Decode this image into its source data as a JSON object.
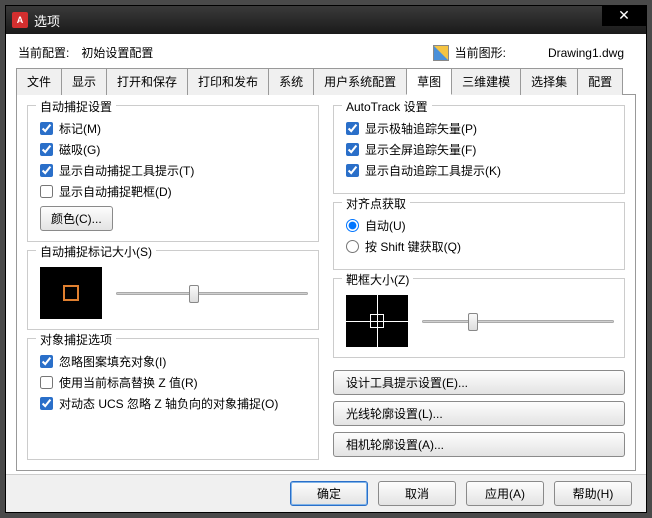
{
  "title": "选项",
  "top": {
    "profile_label": "当前配置:",
    "profile_value": "初始设置配置",
    "drawing_label": "当前图形:",
    "drawing_value": "Drawing1.dwg"
  },
  "tabs": [
    "文件",
    "显示",
    "打开和保存",
    "打印和发布",
    "系统",
    "用户系统配置",
    "草图",
    "三维建模",
    "选择集",
    "配置"
  ],
  "active_tab": 6,
  "left": {
    "autosnap": {
      "title": "自动捕捉设置",
      "marker": "标记(M)",
      "magnet": "磁吸(G)",
      "tooltip": "显示自动捕捉工具提示(T)",
      "aperture": "显示自动捕捉靶框(D)",
      "colors_btn": "颜色(C)..."
    },
    "marker_size": {
      "title": "自动捕捉标记大小(S)"
    },
    "osnap": {
      "title": "对象捕捉选项",
      "hatch": "忽略图案填充对象(I)",
      "elev": "使用当前标高替换 Z 值(R)",
      "negz": "对动态 UCS 忽略 Z 轴负向的对象捕捉(O)"
    }
  },
  "right": {
    "autotrack": {
      "title": "AutoTrack 设置",
      "polar": "显示极轴追踪矢量(P)",
      "full": "显示全屏追踪矢量(F)",
      "tip": "显示自动追踪工具提示(K)"
    },
    "align": {
      "title": "对齐点获取",
      "auto": "自动(U)",
      "shift": "按 Shift 键获取(Q)"
    },
    "aperture_size": {
      "title": "靶框大小(Z)"
    },
    "btn_design": "设计工具提示设置(E)...",
    "btn_light": "光线轮廓设置(L)...",
    "btn_camera": "相机轮廓设置(A)..."
  },
  "footer": {
    "ok": "确定",
    "cancel": "取消",
    "apply": "应用(A)",
    "help": "帮助(H)"
  }
}
